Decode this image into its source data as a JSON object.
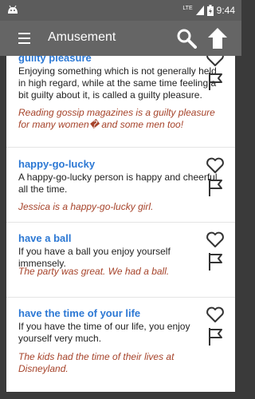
{
  "status_bar": {
    "network_label": "LTE",
    "time": "9:44",
    "icons": [
      "android-icon",
      "signal-icon",
      "battery-icon"
    ]
  },
  "app_bar": {
    "title": "Amusement",
    "icons": [
      "menu-icon",
      "search-icon",
      "arrow-up-icon"
    ]
  },
  "entries": [
    {
      "term": "guilty pleasure",
      "definition": "Enjoying something which is not generally held in high regard, while at the same time feeling a bit guilty about it, is called a guilty pleasure.",
      "example": "Reading gossip magazines is a guilty pleasure for many women� and some men too!"
    },
    {
      "term": "happy-go-lucky",
      "definition": "A happy-go-lucky person is happy and cheerful all the time.",
      "example": "Jessica is a happy-go-lucky girl."
    },
    {
      "term": "have a ball",
      "definition": "If you have a ball you enjoy yourself immensely.",
      "example": "The party was great. We had a ball."
    },
    {
      "term": "have the time of your life",
      "definition": "If you have the time of our life, you enjoy yourself very much.",
      "example": "The kids had the time of their lives at Disneyland."
    }
  ],
  "colors": {
    "term": "#2c78d4",
    "example": "#a6432a",
    "app_bar": "#656565",
    "status_bar": "#5c5c5c"
  }
}
